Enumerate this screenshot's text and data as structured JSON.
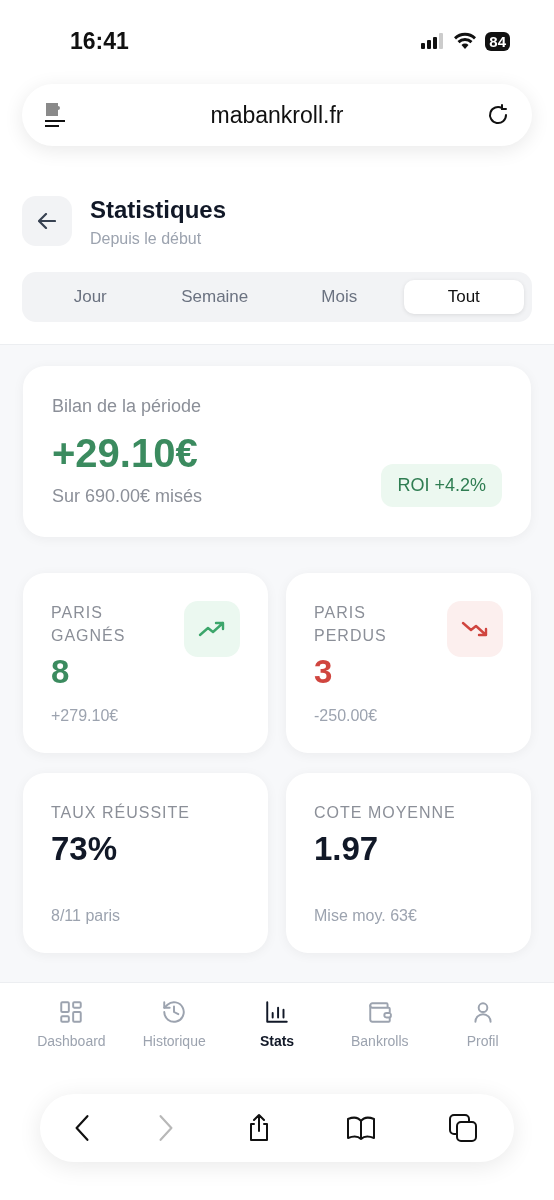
{
  "status_bar": {
    "time": "16:41",
    "battery": "84"
  },
  "browser": {
    "url": "mabankroll.fr"
  },
  "header": {
    "title": "Statistiques",
    "subtitle": "Depuis le début"
  },
  "periods": [
    {
      "label": "Jour",
      "selected": false
    },
    {
      "label": "Semaine",
      "selected": false
    },
    {
      "label": "Mois",
      "selected": false
    },
    {
      "label": "Tout",
      "selected": true
    }
  ],
  "summary": {
    "label": "Bilan de la période",
    "amount": "+29.10€",
    "staked": "Sur 690.00€ misés",
    "roi": "ROI +4.2%"
  },
  "stats": [
    {
      "label": "PARIS GAGNÉS",
      "value": "8",
      "detail": "+279.10€",
      "kind": "gain"
    },
    {
      "label": "PARIS PERDUS",
      "value": "3",
      "detail": "-250.00€",
      "kind": "loss"
    },
    {
      "label": "TAUX RÉUSSITE",
      "value": "73%",
      "detail": "8/11 paris",
      "kind": "plain"
    },
    {
      "label": "COTE MOYENNE",
      "value": "1.97",
      "detail": "Mise moy. 63€",
      "kind": "plain"
    }
  ],
  "nav": [
    {
      "label": "Dashboard",
      "kind": "grid",
      "selected": false
    },
    {
      "label": "Historique",
      "kind": "history",
      "selected": false
    },
    {
      "label": "Stats",
      "kind": "chart",
      "selected": true
    },
    {
      "label": "Bankrolls",
      "kind": "wallet",
      "selected": false
    },
    {
      "label": "Profil",
      "kind": "user",
      "selected": false
    }
  ],
  "toolbar": [
    {
      "kind": "back",
      "disabled": false
    },
    {
      "kind": "forward",
      "disabled": true
    },
    {
      "kind": "share",
      "disabled": false
    },
    {
      "kind": "book",
      "disabled": false
    },
    {
      "kind": "tabs",
      "disabled": false
    }
  ]
}
